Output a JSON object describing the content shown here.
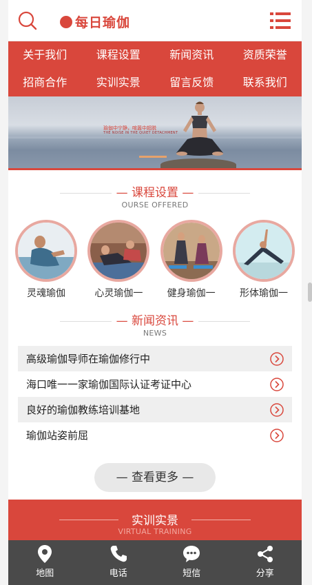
{
  "header": {
    "logo_text": "每日瑜伽",
    "brand_color": "#d9473c"
  },
  "nav": [
    {
      "label": "关于我们"
    },
    {
      "label": "课程设置"
    },
    {
      "label": "新闻资讯"
    },
    {
      "label": "资质荣誉"
    },
    {
      "label": "招商合作"
    },
    {
      "label": "实训实景"
    },
    {
      "label": "留言反馈"
    },
    {
      "label": "联系我们"
    }
  ],
  "banner": {
    "line1": "瑜伽中宁静，喧嚣中超脱",
    "line2": "THE NOISE IN THE QUIET DETACHMENT"
  },
  "courses_section": {
    "title": "课程设置",
    "subtitle": "OURSE OFFERED",
    "items": [
      {
        "name": "灵魂瑜伽"
      },
      {
        "name": "心灵瑜伽一"
      },
      {
        "name": "健身瑜伽一"
      },
      {
        "name": "形体瑜伽一"
      }
    ]
  },
  "news_section": {
    "title": "新闻资讯",
    "subtitle": "NEWS",
    "items": [
      {
        "text": "高级瑜伽导师在瑜伽修行中"
      },
      {
        "text": "海口唯一一家瑜伽国际认证考证中心"
      },
      {
        "text": "良好的瑜伽教练培训基地"
      },
      {
        "text": "瑜伽站姿前屈"
      }
    ],
    "more_label": "— 查看更多 —"
  },
  "training_section": {
    "title": "实训实景",
    "subtitle": "VIRTUAL TRAINING"
  },
  "footer": [
    {
      "label": "地图",
      "icon": "map-pin-icon"
    },
    {
      "label": "电话",
      "icon": "phone-icon"
    },
    {
      "label": "短信",
      "icon": "message-icon"
    },
    {
      "label": "分享",
      "icon": "share-icon"
    }
  ]
}
